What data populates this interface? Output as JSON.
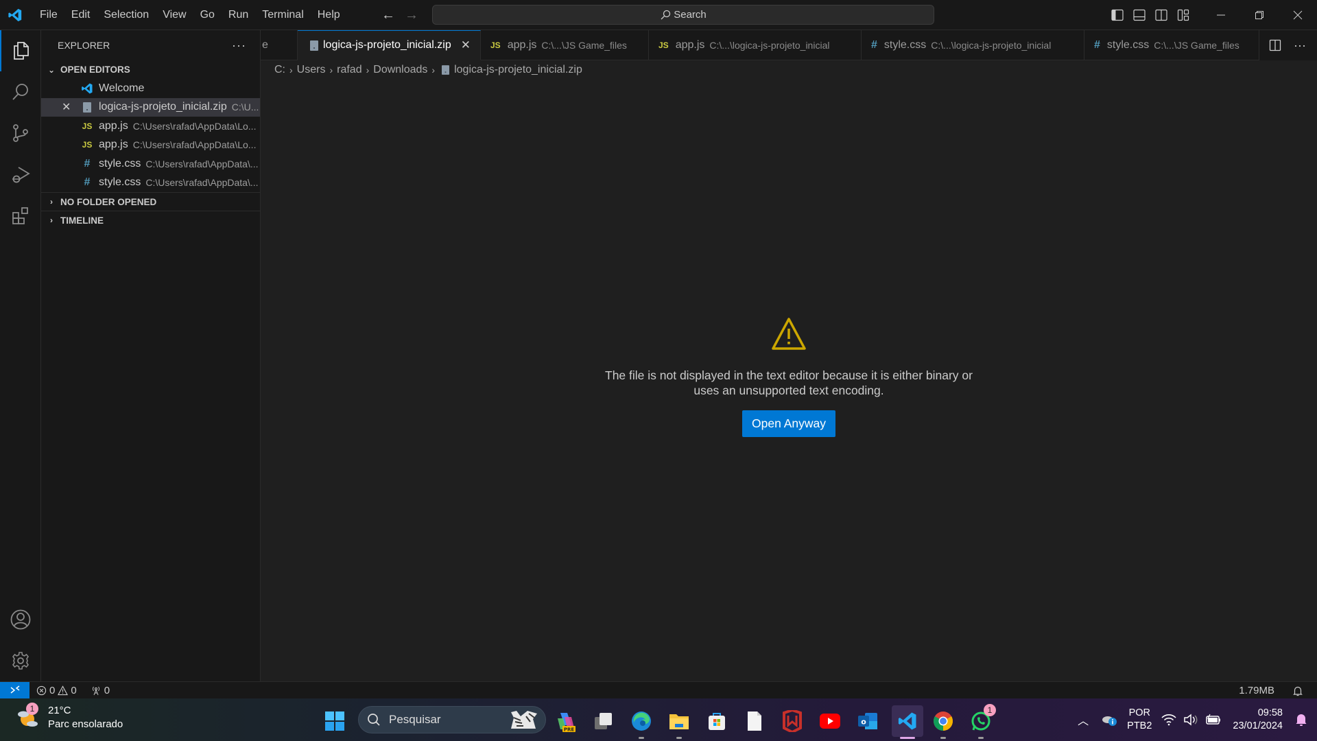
{
  "titlebar": {
    "menu": [
      "File",
      "Edit",
      "Selection",
      "View",
      "Go",
      "Run",
      "Terminal",
      "Help"
    ],
    "search_placeholder": "Search"
  },
  "sidebar": {
    "title": "EXPLORER",
    "more": "···",
    "open_editors_label": "OPEN EDITORS",
    "open_editors": [
      {
        "name": "Welcome",
        "desc": "",
        "icon": "vscode-icon"
      },
      {
        "name": "logica-js-projeto_inicial.zip",
        "desc": "C:\\U...",
        "icon": "binary-file-icon",
        "selected": true
      },
      {
        "name": "app.js",
        "desc": "C:\\Users\\rafad\\AppData\\Lo...",
        "icon": "js-file-icon"
      },
      {
        "name": "app.js",
        "desc": "C:\\Users\\rafad\\AppData\\Lo...",
        "icon": "js-file-icon"
      },
      {
        "name": "style.css",
        "desc": "C:\\Users\\rafad\\AppData\\...",
        "icon": "css-file-icon"
      },
      {
        "name": "style.css",
        "desc": "C:\\Users\\rafad\\AppData\\...",
        "icon": "css-file-icon"
      }
    ],
    "no_folder_label": "NO FOLDER OPENED",
    "timeline_label": "TIMELINE"
  },
  "tabs": {
    "clipped": "e",
    "items": [
      {
        "name": "logica-js-projeto_inicial.zip",
        "desc": "",
        "icon": "binary-file-icon",
        "active": true
      },
      {
        "name": "app.js",
        "desc": "C:\\...\\JS Game_files",
        "icon": "js-file-icon"
      },
      {
        "name": "app.js",
        "desc": "C:\\...\\logica-js-projeto_inicial",
        "icon": "js-file-icon"
      },
      {
        "name": "style.css",
        "desc": "C:\\...\\logica-js-projeto_inicial",
        "icon": "css-file-icon"
      },
      {
        "name": "style.css",
        "desc": "C:\\...\\JS Game_files",
        "icon": "css-file-icon"
      }
    ],
    "js_badge": "JS",
    "css_badge": "#"
  },
  "breadcrumb": [
    "C:",
    "Users",
    "rafad",
    "Downloads",
    "logica-js-projeto_inicial.zip"
  ],
  "editor": {
    "message": "The file is not displayed in the text editor because it is either binary or uses an unsupported text encoding.",
    "open_anyway_label": "Open Anyway",
    "warning_color": "#cca700",
    "button_color": "#0078d4"
  },
  "statusbar": {
    "errors": "0",
    "warnings": "0",
    "ports": "0",
    "file_size": "1.79MB"
  },
  "taskbar": {
    "weather_temp": "21°C",
    "weather_desc": "Parc ensolarado",
    "weather_badge": "1",
    "search_placeholder": "Pesquisar",
    "copilot_badge": "PRE",
    "whatsapp_badge": "1",
    "lang_line1": "POR",
    "lang_line2": "PTB2",
    "time": "09:58",
    "date": "23/01/2024"
  }
}
